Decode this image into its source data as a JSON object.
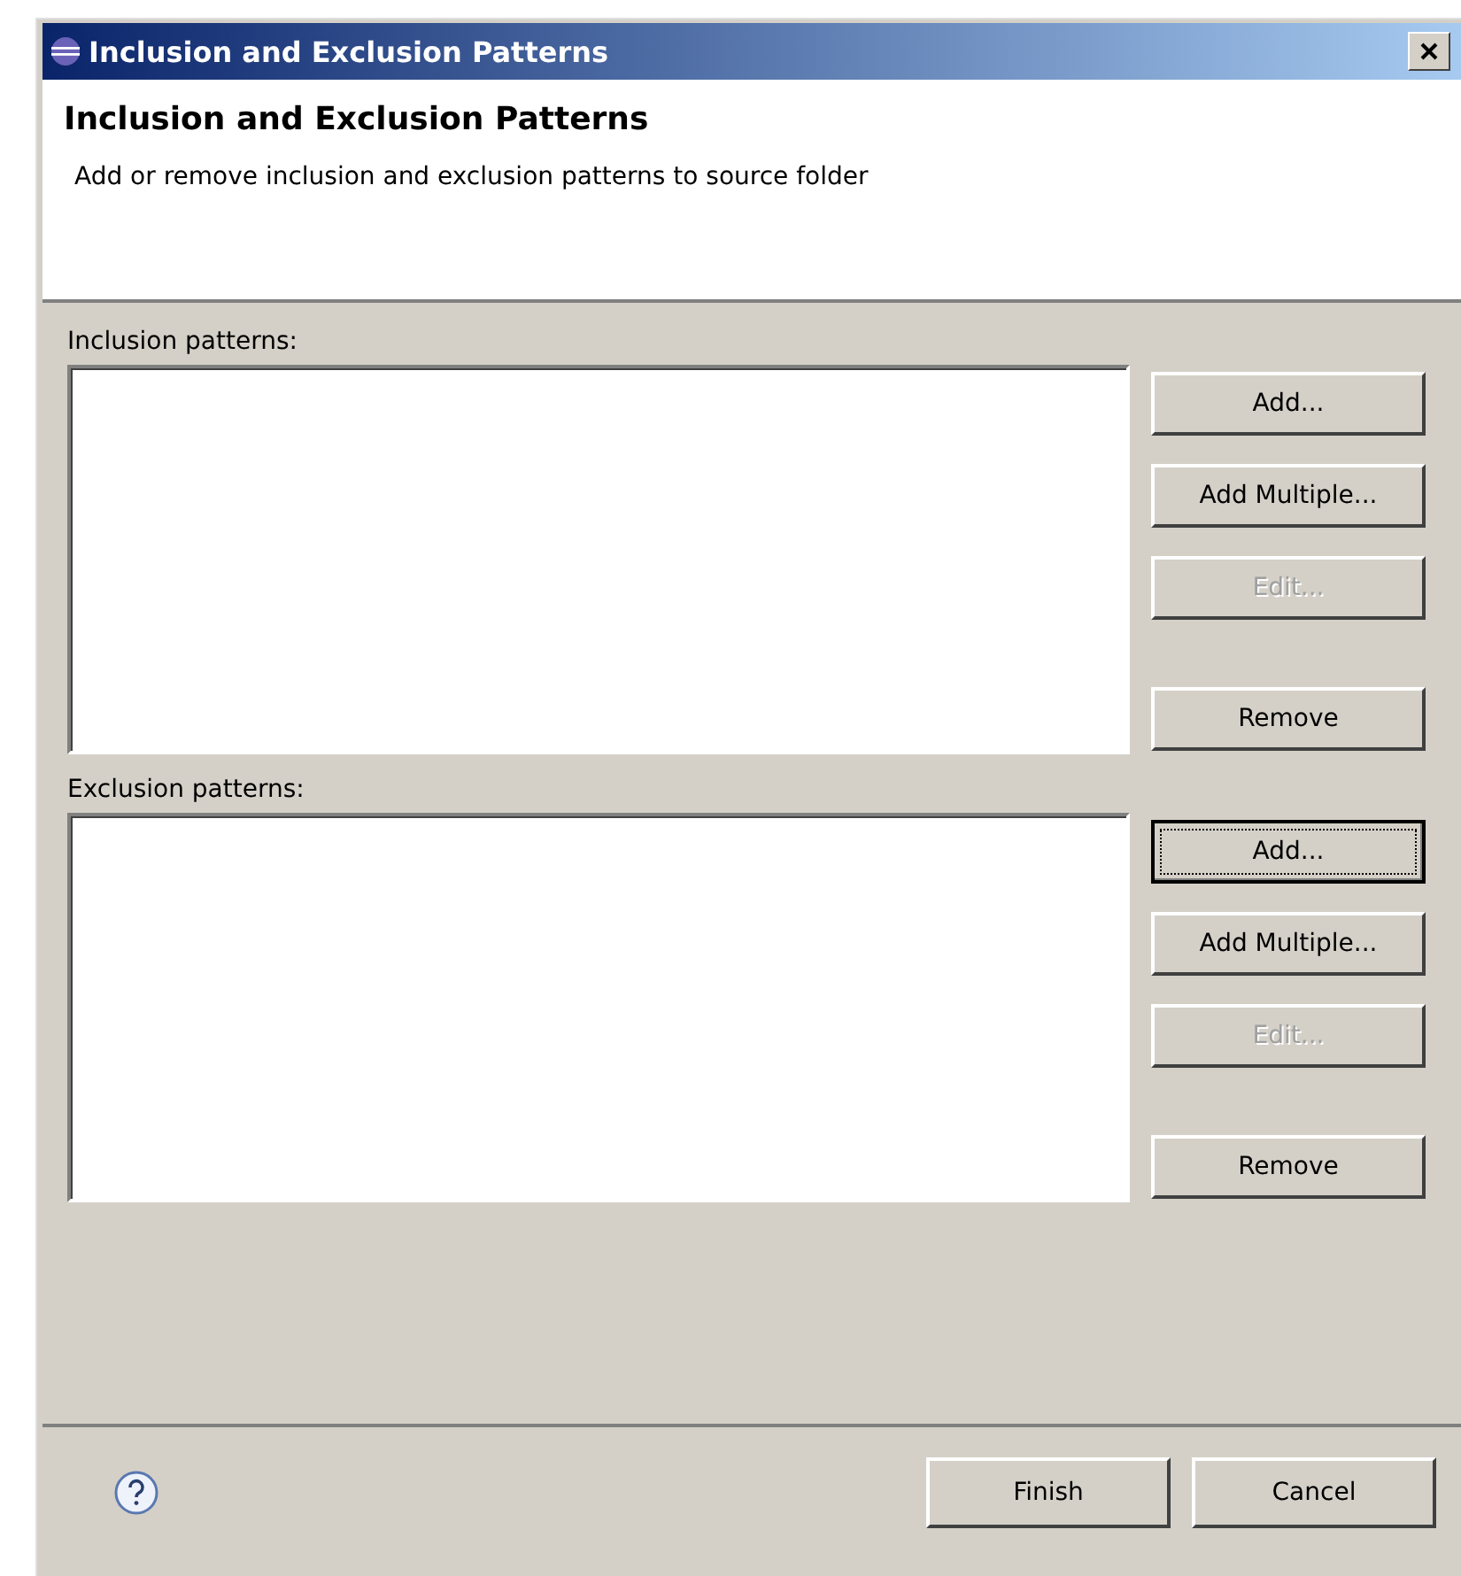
{
  "window": {
    "title": "Inclusion and Exclusion Patterns"
  },
  "header": {
    "title": "Inclusion and Exclusion Patterns",
    "description": "Add or remove inclusion and exclusion patterns to source folder"
  },
  "sections": [
    {
      "label": "Inclusion patterns:",
      "buttons": [
        {
          "label": "Add...",
          "disabled": false,
          "focused": false
        },
        {
          "label": "Add Multiple...",
          "disabled": false,
          "focused": false
        },
        {
          "label": "Edit...",
          "disabled": true,
          "focused": false
        },
        {
          "label": "Remove",
          "disabled": false,
          "focused": false
        }
      ]
    },
    {
      "label": "Exclusion patterns:",
      "buttons": [
        {
          "label": "Add...",
          "disabled": false,
          "focused": true
        },
        {
          "label": "Add Multiple...",
          "disabled": false,
          "focused": false
        },
        {
          "label": "Edit...",
          "disabled": true,
          "focused": false
        },
        {
          "label": "Remove",
          "disabled": false,
          "focused": false
        }
      ]
    }
  ],
  "footer": {
    "buttons": [
      "Finish",
      "Cancel"
    ]
  }
}
